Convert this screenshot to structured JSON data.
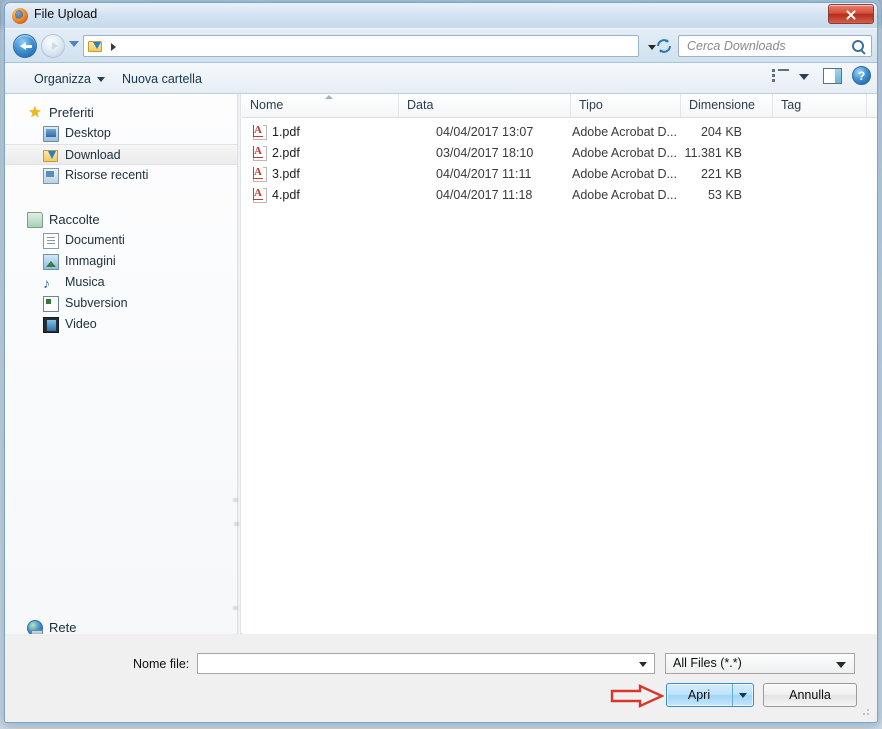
{
  "window": {
    "title": "File Upload",
    "app_icon": "firefox-icon",
    "close_label": "✕"
  },
  "navigation": {
    "back_icon": "back-arrow-icon",
    "forward_icon": "forward-arrow-icon",
    "history_dropdown_icon": "chevron-down-icon",
    "breadcrumb_icon": "downloads-folder-icon",
    "breadcrumb_path": "",
    "address_dropdown_icon": "chevron-down-icon",
    "refresh_icon": "refresh-icon"
  },
  "search": {
    "placeholder": "Cerca Downloads",
    "value": "",
    "icon": "search-icon"
  },
  "toolbar": {
    "organize_label": "Organizza",
    "new_folder_label": "Nuova cartella",
    "view_icon": "view-list-icon",
    "view_dropdown_icon": "chevron-down-icon",
    "preview_pane_icon": "preview-pane-icon",
    "help_icon": "help-icon",
    "help_glyph": "?"
  },
  "sidebar": {
    "groups": [
      {
        "label": "Preferiti",
        "icon": "star-icon",
        "items": [
          {
            "label": "Desktop",
            "icon": "desktop-icon",
            "selected": false
          },
          {
            "label": "Download",
            "icon": "downloads-folder-icon",
            "selected": true
          },
          {
            "label": "Risorse recenti",
            "icon": "recent-places-icon",
            "selected": false
          }
        ]
      },
      {
        "label": "Raccolte",
        "icon": "libraries-icon",
        "items": [
          {
            "label": "Documenti",
            "icon": "documents-icon",
            "selected": false
          },
          {
            "label": "Immagini",
            "icon": "pictures-icon",
            "selected": false
          },
          {
            "label": "Musica",
            "icon": "music-icon",
            "selected": false
          },
          {
            "label": "Subversion",
            "icon": "subversion-icon",
            "selected": false
          },
          {
            "label": "Video",
            "icon": "video-icon",
            "selected": false
          }
        ]
      },
      {
        "label": "Rete",
        "icon": "network-icon",
        "items": []
      }
    ]
  },
  "file_list": {
    "columns": [
      {
        "label": "Nome",
        "sorted": "asc"
      },
      {
        "label": "Data",
        "sorted": ""
      },
      {
        "label": "Tipo",
        "sorted": ""
      },
      {
        "label": "Dimensione",
        "sorted": ""
      },
      {
        "label": "Tag",
        "sorted": ""
      }
    ],
    "rows": [
      {
        "name": "1.pdf",
        "date": "04/04/2017 13:07",
        "type": "Adobe Acrobat D...",
        "size": "204 KB",
        "tag": "",
        "icon": "pdf-file-icon"
      },
      {
        "name": "2.pdf",
        "date": "03/04/2017 18:10",
        "type": "Adobe Acrobat D...",
        "size": "11.381 KB",
        "tag": "",
        "icon": "pdf-file-icon"
      },
      {
        "name": "3.pdf",
        "date": "04/04/2017 11:11",
        "type": "Adobe Acrobat D...",
        "size": "221 KB",
        "tag": "",
        "icon": "pdf-file-icon"
      },
      {
        "name": "4.pdf",
        "date": "04/04/2017 11:18",
        "type": "Adobe Acrobat D...",
        "size": "53 KB",
        "tag": "",
        "icon": "pdf-file-icon"
      }
    ]
  },
  "footer": {
    "filename_label": "Nome file:",
    "filename_value": "",
    "filter_value": "All Files (*.*)",
    "open_label": "Apri",
    "open_dropdown_icon": "chevron-down-icon",
    "cancel_label": "Annulla"
  },
  "annotation": {
    "arrow_icon": "red-arrow-right-icon",
    "arrow_color": "#d8382c",
    "points_at": "Apri"
  },
  "colors": {
    "accent": "#3c8dc5",
    "selection": "#ebebeb",
    "close_button": "#c0392b"
  }
}
